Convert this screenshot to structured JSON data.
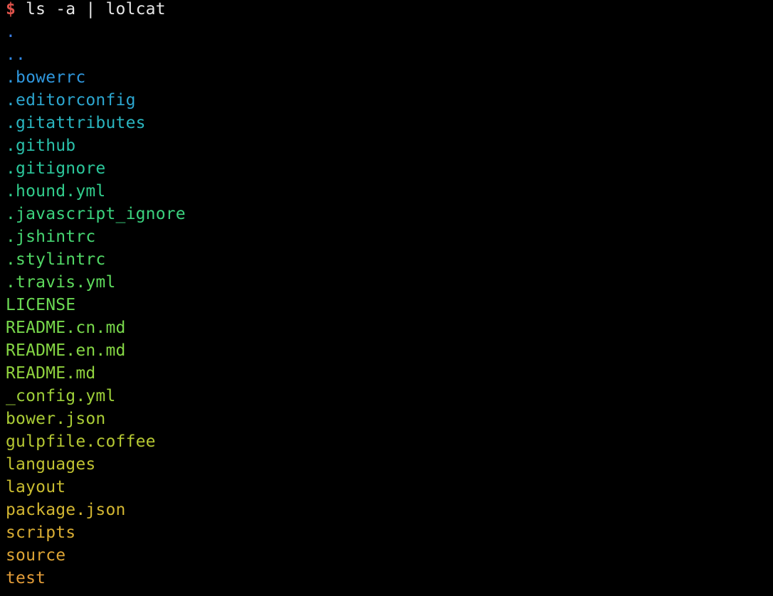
{
  "prompt": {
    "symbol": "$",
    "symbol_color": "#e0534b",
    "command": " ls -a | lolcat",
    "command_color": "#e6e6e6"
  },
  "entries": [
    {
      "name": ".",
      "color": "#3b7ee6"
    },
    {
      "name": "..",
      "color": "#3088e3"
    },
    {
      "name": ".bowerrc",
      "color": "#2f97dd"
    },
    {
      "name": ".editorconfig",
      "color": "#2ca6cf"
    },
    {
      "name": ".gitattributes",
      "color": "#2ab5bf"
    },
    {
      "name": ".github",
      "color": "#2ac0aa"
    },
    {
      "name": ".gitignore",
      "color": "#2bc79b"
    },
    {
      "name": ".hound.yml",
      "color": "#31cd8c"
    },
    {
      "name": ".javascript_ignore",
      "color": "#3bd27e"
    },
    {
      "name": ".jshintrc",
      "color": "#46d672"
    },
    {
      "name": ".stylintrc",
      "color": "#52d866"
    },
    {
      "name": ".travis.yml",
      "color": "#5eda5c"
    },
    {
      "name": "LICENSE",
      "color": "#6bd953"
    },
    {
      "name": "README.cn.md",
      "color": "#78d84b"
    },
    {
      "name": "README.en.md",
      "color": "#85d644"
    },
    {
      "name": "README.md",
      "color": "#91d33e"
    },
    {
      "name": "_config.yml",
      "color": "#9ed039"
    },
    {
      "name": "bower.json",
      "color": "#aacc35"
    },
    {
      "name": "gulpfile.coffee",
      "color": "#b5c732"
    },
    {
      "name": "languages",
      "color": "#c0c231"
    },
    {
      "name": "layout",
      "color": "#c9bc30"
    },
    {
      "name": "package.json",
      "color": "#d2b531"
    },
    {
      "name": "scripts",
      "color": "#d9ad33"
    },
    {
      "name": "source",
      "color": "#dea535"
    },
    {
      "name": "test",
      "color": "#e29c38"
    }
  ]
}
